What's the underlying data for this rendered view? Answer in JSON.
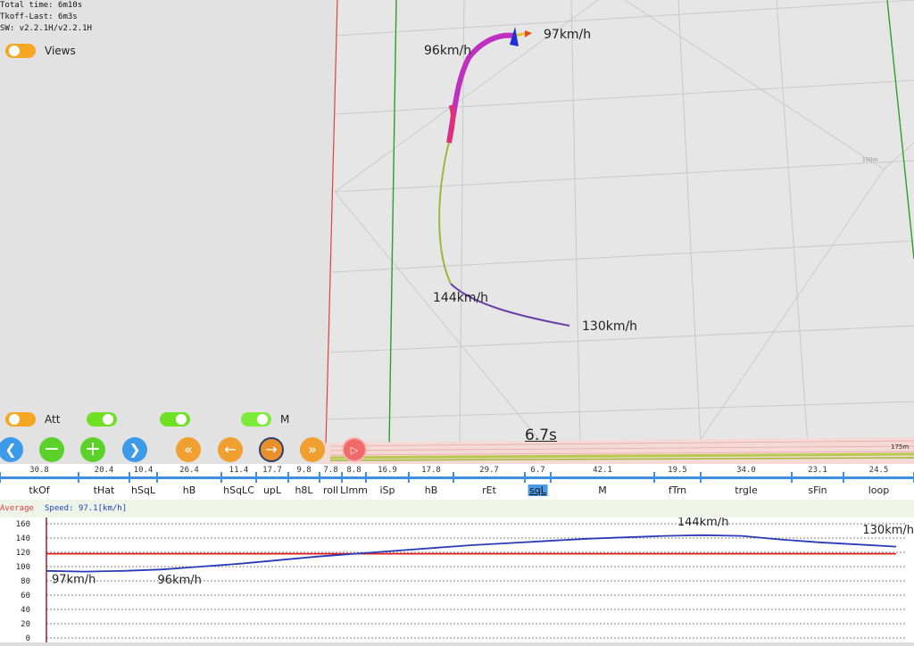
{
  "info": {
    "total_time": "Total time: 6m10s",
    "tkoff_last": "Tkoff-Last: 6m3s",
    "sw_version": "SW: v2.2.1H/v2.2.1H"
  },
  "toggles": {
    "views_label": "Views",
    "att_label": "Att",
    "m_label": "M"
  },
  "scene": {
    "speed_labels": [
      "97km/h",
      "96km/h",
      "144km/h",
      "130km/h"
    ],
    "distance_labels": [
      "175m",
      "150m"
    ]
  },
  "duration_label": "6.7s",
  "controls": {
    "prev_icon": "chevron-left-icon",
    "zoom_out_icon": "minus-icon",
    "zoom_in_icon": "plus-icon",
    "next_icon": "chevron-right-icon",
    "rewind_icon": "double-chevron-left-icon",
    "step_back_icon": "arrow-left-icon",
    "step_forward_icon": "arrow-right-icon",
    "fast_forward_icon": "double-chevron-right-icon",
    "play_icon": "play-icon"
  },
  "timeline": {
    "values": [
      "30.8",
      "20.4",
      "10.4",
      "26.4",
      "11.4",
      "17.7",
      "9.8",
      "7.8",
      "8.8",
      "16.9",
      "17.8",
      "29.7",
      "6.7",
      "42.1",
      "19.5",
      "34.0",
      "23.1",
      "24.5"
    ],
    "names": [
      "tkOf",
      "tHat",
      "hSqL",
      "hB",
      "hSqLC",
      "upL",
      "h8L",
      "roll",
      "LImm",
      "iSp",
      "hB",
      "rEt",
      "sqL",
      "M",
      "fTrn",
      "trgle",
      "sFin",
      "loop"
    ],
    "active_index": 12
  },
  "chart_header": {
    "average_label": "Average",
    "speed_text": "Speed: 97.1[km/h]"
  },
  "chart_data": {
    "type": "line",
    "y_ticks": [
      160,
      140,
      120,
      100,
      80,
      60,
      40,
      20,
      0
    ],
    "ylim": [
      0,
      165
    ],
    "average": 118,
    "series": [
      {
        "values": [
          94,
          93,
          94,
          96,
          100,
          104,
          109,
          114,
          118,
          122,
          126,
          130,
          133,
          136,
          139,
          141,
          143,
          144,
          143,
          138,
          134,
          131,
          128
        ]
      }
    ],
    "annotations": [
      {
        "label": "97km/h",
        "index": 0,
        "value": 97
      },
      {
        "label": "96km/h",
        "index": 2,
        "value": 96
      },
      {
        "label": "144km/h",
        "index": 17,
        "value": 144
      },
      {
        "label": "130km/h",
        "index": 22,
        "value": 130
      }
    ],
    "colors": {
      "line": "#2a3bb8",
      "average": "#e02020"
    }
  }
}
